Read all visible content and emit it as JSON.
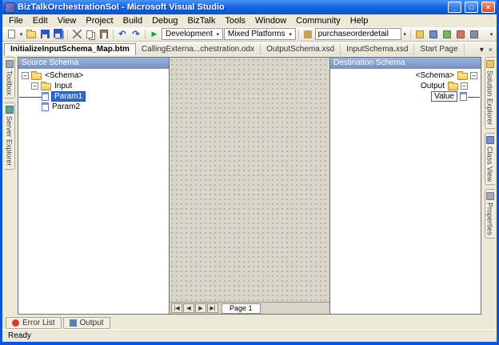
{
  "window": {
    "title": "BizTalkOrchestrationSol - Microsoft Visual Studio"
  },
  "menu": {
    "items": [
      "File",
      "Edit",
      "View",
      "Project",
      "Build",
      "Debug",
      "BizTalk",
      "Tools",
      "Window",
      "Community",
      "Help"
    ]
  },
  "toolbar": {
    "development": "Development",
    "platforms": "Mixed Platforms",
    "search_value": "purchaseorderdetail",
    "icon_names": [
      "new-item",
      "open-file",
      "save",
      "save-all",
      "cut",
      "copy",
      "paste",
      "undo",
      "redo",
      "start-debugging",
      "solution-explorer",
      "properties-window",
      "object-browser",
      "toolbox",
      "start-page"
    ]
  },
  "doc_tabs": {
    "items": [
      "InitializeInputSchema_Map.btm",
      "CallingExterna...chestration.odx",
      "OutputSchema.xsd",
      "InputSchema.xsd",
      "Start Page"
    ],
    "active": "InitializeInputSchema_Map.btm"
  },
  "left_tabs": {
    "items": [
      "Toolbox",
      "Server Explorer"
    ]
  },
  "right_tabs": {
    "items": [
      "Solution Explorer",
      "Class View",
      "Properties"
    ]
  },
  "mapper": {
    "source_header": "Source Schema",
    "destination_header": "Destination Schema",
    "source_tree": [
      {
        "label": "<Schema>",
        "level": 0,
        "type": "folder"
      },
      {
        "label": "Input",
        "level": 1,
        "type": "folder"
      },
      {
        "label": "Param1",
        "level": 2,
        "type": "field",
        "selected": true
      },
      {
        "label": "Param2",
        "level": 2,
        "type": "field"
      }
    ],
    "destination_tree": [
      {
        "label": "<Schema>",
        "level": 0,
        "type": "folder"
      },
      {
        "label": "Output",
        "level": 1,
        "type": "folder"
      },
      {
        "label": "Value",
        "level": 2,
        "type": "field",
        "linked": true
      }
    ],
    "pager_label": "Page 1"
  },
  "bottom_tabs": {
    "items": [
      "Error List",
      "Output"
    ]
  },
  "status": {
    "text": "Ready"
  },
  "glyphs": {
    "collapse": "−",
    "run": "▶",
    "undo": "↶",
    "redo": "↷",
    "combo_arrow": "▾",
    "tab_menu": "▼",
    "tab_close": "×",
    "window_min": "_",
    "window_max": "□",
    "window_close": "×",
    "nav_first": "|◀",
    "nav_prev": "◀",
    "nav_next": "▶",
    "nav_last": "▶|"
  },
  "colors": {
    "titlebar_blue": "#0A55DE",
    "selection_blue": "#316AC5",
    "panel_header_blue": "#7E9BC9",
    "chrome": "#ECE9D8",
    "grid_background": "#D9D5C9"
  }
}
